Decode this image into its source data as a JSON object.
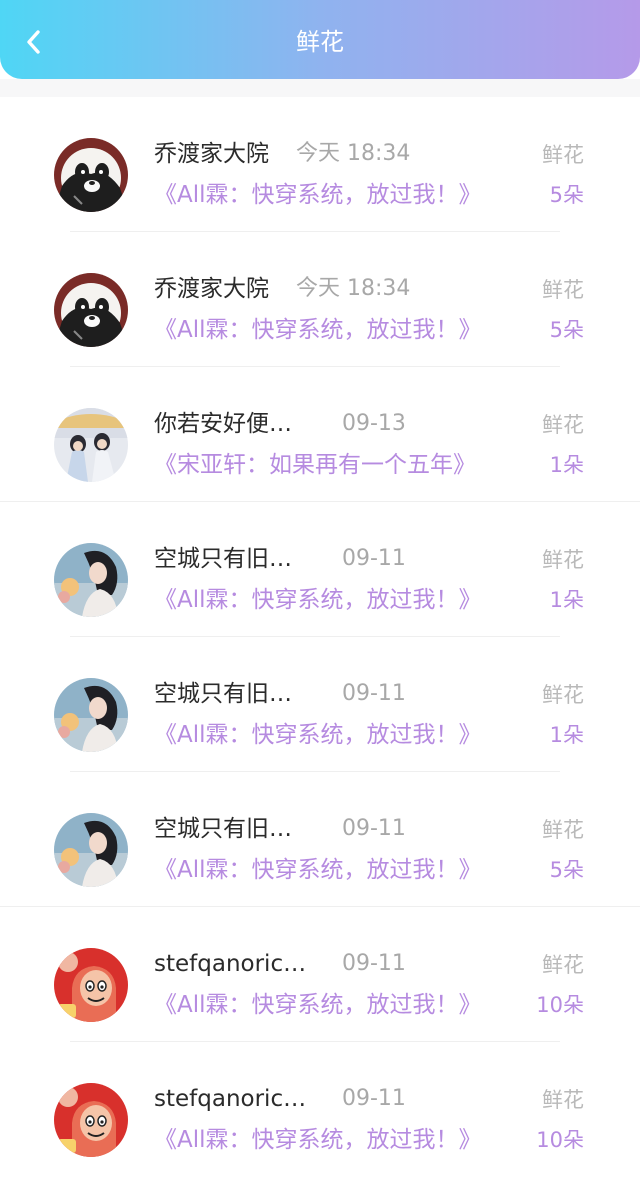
{
  "header": {
    "title": "鲜花",
    "back_icon": "chevron-left-icon",
    "gradient": [
      "#4fd6f5",
      "#b59ae9"
    ]
  },
  "colors": {
    "accent": "#b68be0",
    "name_text": "#2b2b2b",
    "muted_text": "#a8a8a8"
  },
  "list": [
    {
      "name": "乔渡家大院",
      "time": "今天 18:34",
      "book": "《All霖：快穿系统，放过我！》",
      "flower_label": "鲜花",
      "count": "5朵",
      "avatar": "panda-avatar"
    },
    {
      "name": "乔渡家大院",
      "time": "今天 18:34",
      "book": "《All霖：快穿系统，放过我！》",
      "flower_label": "鲜花",
      "count": "5朵",
      "avatar": "panda-avatar"
    },
    {
      "name": "你若安好便…",
      "time": "09-13",
      "book": "《宋亚轩：如果再有一个五年》",
      "flower_label": "鲜花",
      "count": "1朵",
      "avatar": "photo-avatar"
    },
    {
      "name": "空城只有旧…",
      "time": "09-11",
      "book": "《All霖：快穿系统，放过我！》",
      "flower_label": "鲜花",
      "count": "1朵",
      "avatar": "girl-photo-avatar"
    },
    {
      "name": "空城只有旧…",
      "time": "09-11",
      "book": "《All霖：快穿系统，放过我！》",
      "flower_label": "鲜花",
      "count": "1朵",
      "avatar": "girl-photo-avatar"
    },
    {
      "name": "空城只有旧…",
      "time": "09-11",
      "book": "《All霖：快穿系统，放过我！》",
      "flower_label": "鲜花",
      "count": "5朵",
      "avatar": "girl-photo-avatar"
    },
    {
      "name": "stefqanoric…",
      "time": "09-11",
      "book": "《All霖：快穿系统，放过我！》",
      "flower_label": "鲜花",
      "count": "10朵",
      "avatar": "cartoon-avatar"
    },
    {
      "name": "stefqanoric…",
      "time": "09-11",
      "book": "《All霖：快穿系统，放过我！》",
      "flower_label": "鲜花",
      "count": "10朵",
      "avatar": "cartoon-avatar"
    }
  ]
}
